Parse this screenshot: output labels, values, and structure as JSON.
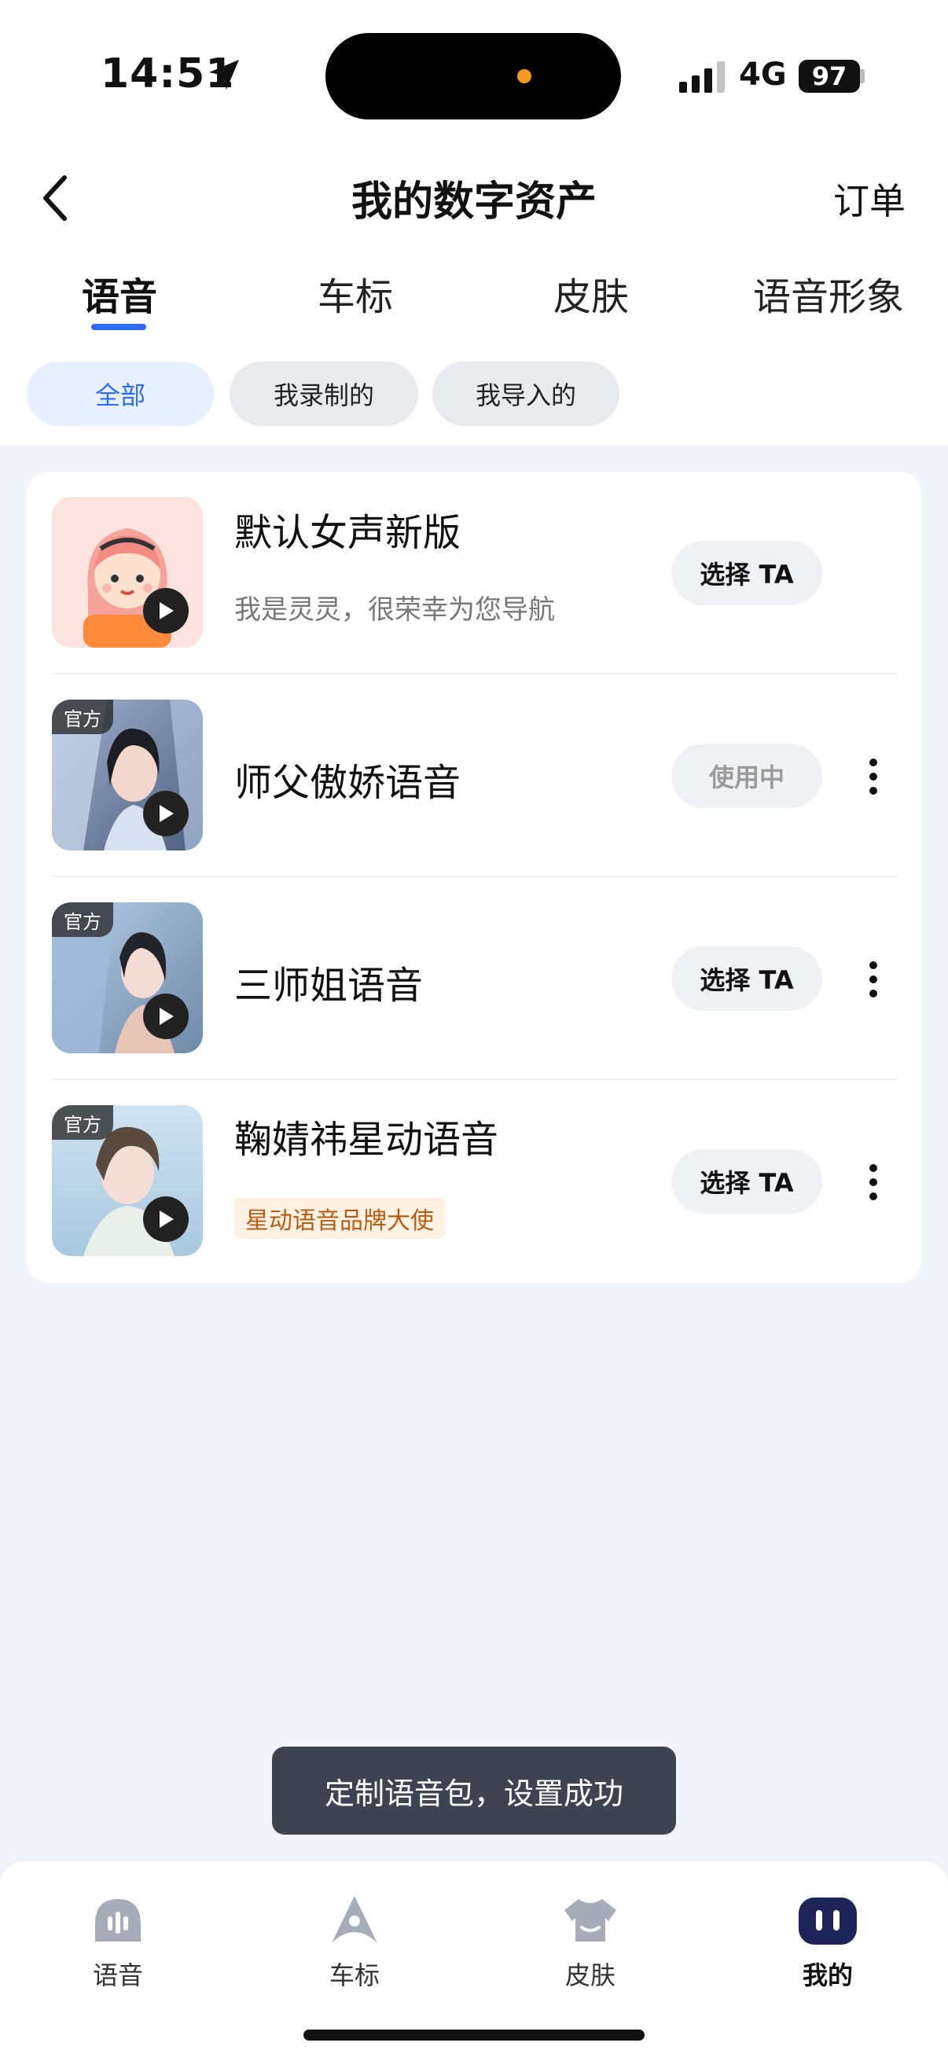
{
  "status_bar": {
    "time": "14:51",
    "network": "4G",
    "battery": "97"
  },
  "header": {
    "title": "我的数字资产",
    "orders_label": "订单"
  },
  "tabs": [
    {
      "label": "语音",
      "active": true
    },
    {
      "label": "车标",
      "active": false
    },
    {
      "label": "皮肤",
      "active": false
    },
    {
      "label": "语音形象",
      "active": false
    }
  ],
  "filters": [
    {
      "label": "全部",
      "active": true
    },
    {
      "label": "我录制的",
      "active": false
    },
    {
      "label": "我导入的",
      "active": false
    }
  ],
  "voices": [
    {
      "name": "默认女声新版",
      "subtitle": "我是灵灵，很荣幸为您导航",
      "action": "选择 TA",
      "official": false
    },
    {
      "name": "师父傲娇语音",
      "action": "使用中",
      "official": true,
      "badge": "官方",
      "in_use": true
    },
    {
      "name": "三师姐语音",
      "action": "选择 TA",
      "official": true,
      "badge": "官方"
    },
    {
      "name": "鞠婧祎星动语音",
      "tag": "星动语音品牌大使",
      "action": "选择 TA",
      "official": true,
      "badge": "官方"
    }
  ],
  "toast": "定制语音包，设置成功",
  "bottom_nav": [
    {
      "label": "语音",
      "icon": "voice-icon"
    },
    {
      "label": "车标",
      "icon": "car-logo-icon"
    },
    {
      "label": "皮肤",
      "icon": "skin-icon"
    },
    {
      "label": "我的",
      "icon": "profile-icon",
      "active": true
    }
  ],
  "colors": {
    "accent": "#2f6cf6",
    "background": "#f3f5fa",
    "toast_bg": "#3d4350",
    "promo_text": "#b85c10"
  }
}
